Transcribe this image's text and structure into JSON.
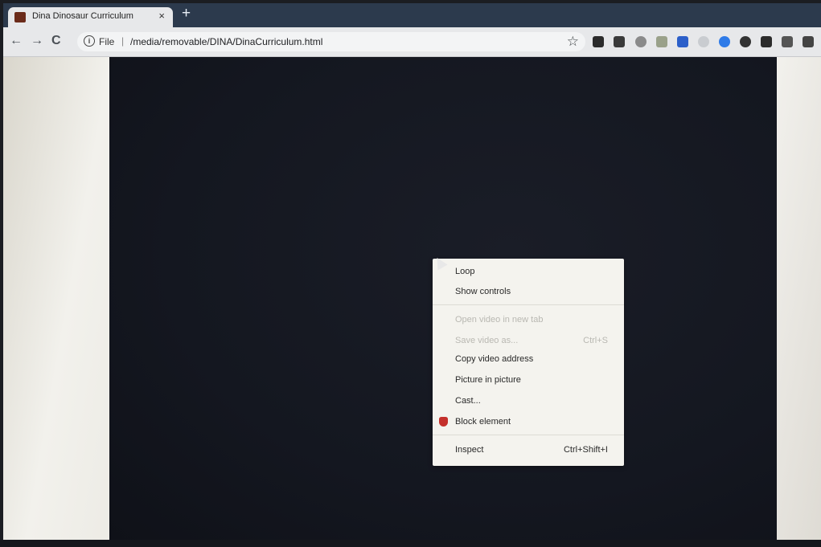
{
  "browser": {
    "tab": {
      "title": "Dina Dinosaur Curriculum",
      "close": "×"
    },
    "new_tab": "+",
    "nav": {
      "back": "←",
      "forward": "→",
      "reload": "C"
    },
    "omnibox": {
      "info": "i",
      "scheme": "File",
      "separator": "|",
      "path": "/media/removable/DINA/DinaCurriculum.html",
      "star": "☆"
    },
    "extensions": [
      {
        "name": "ext-1-icon",
        "color": "#2b2b2b"
      },
      {
        "name": "ext-2-icon",
        "color": "#3a3a3a"
      },
      {
        "name": "ext-3-icon",
        "color": "#8a8a8a"
      },
      {
        "name": "ext-4-icon",
        "color": "#9aa18a"
      },
      {
        "name": "ext-5-icon",
        "color": "#2c5fc9"
      },
      {
        "name": "ext-6-icon",
        "color": "#c9ccd0"
      },
      {
        "name": "ext-7-icon",
        "color": "#2f7be8"
      },
      {
        "name": "ext-8-icon",
        "color": "#333333"
      },
      {
        "name": "ext-9-icon",
        "color": "#2b2b2b"
      },
      {
        "name": "ext-10-icon",
        "color": "#555555"
      },
      {
        "name": "ext-11-icon",
        "color": "#444444"
      }
    ]
  },
  "context_menu": {
    "items": [
      {
        "label": "Loop",
        "shortcut": "",
        "enabled": true
      },
      {
        "label": "Show controls",
        "shortcut": "",
        "enabled": true
      },
      {
        "label": "Open video in new tab",
        "shortcut": "",
        "enabled": false
      },
      {
        "label": "Save video as...",
        "shortcut": "Ctrl+S",
        "enabled": false
      },
      {
        "label": "Copy video address",
        "shortcut": "",
        "enabled": true
      },
      {
        "label": "Picture in picture",
        "shortcut": "",
        "enabled": true
      },
      {
        "label": "Cast...",
        "shortcut": "",
        "enabled": true
      },
      {
        "label": "Block element",
        "shortcut": "",
        "enabled": true,
        "icon": "ublock-icon"
      },
      {
        "label": "Inspect",
        "shortcut": "Ctrl+Shift+I",
        "enabled": true
      }
    ]
  }
}
